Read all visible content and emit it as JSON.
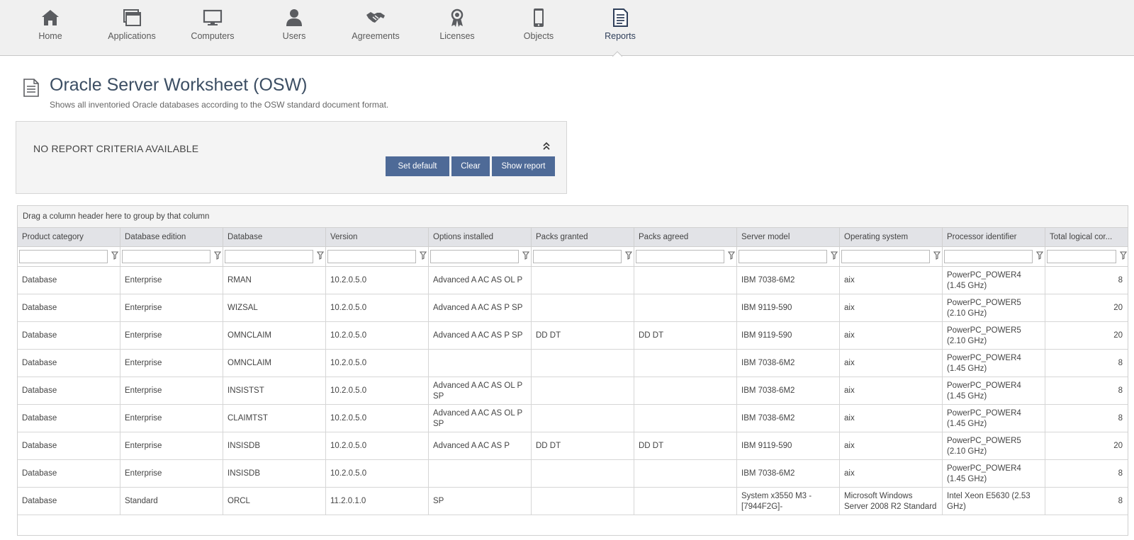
{
  "nav": {
    "items": [
      {
        "label": "Home",
        "icon": "home-icon"
      },
      {
        "label": "Applications",
        "icon": "applications-icon"
      },
      {
        "label": "Computers",
        "icon": "computer-icon"
      },
      {
        "label": "Users",
        "icon": "user-icon"
      },
      {
        "label": "Agreements",
        "icon": "handshake-icon"
      },
      {
        "label": "Licenses",
        "icon": "license-ribbon-icon"
      },
      {
        "label": "Objects",
        "icon": "mobile-device-icon"
      },
      {
        "label": "Reports",
        "icon": "report-document-icon"
      }
    ],
    "active": "Reports"
  },
  "header": {
    "title": "Oracle Server Worksheet (OSW)",
    "subtitle": "Shows all inventoried Oracle databases according to the OSW standard document format."
  },
  "criteria": {
    "text": "NO REPORT CRITERIA AVAILABLE",
    "buttons": {
      "set_default": "Set default",
      "clear": "Clear",
      "show_report": "Show report"
    }
  },
  "grid": {
    "group_hint": "Drag a column header here to group by that column",
    "columns": [
      "Product category",
      "Database edition",
      "Database",
      "Version",
      "Options installed",
      "Packs granted",
      "Packs agreed",
      "Server model",
      "Operating system",
      "Processor identifier",
      "Total logical cor..."
    ],
    "rows": [
      [
        "Database",
        "Enterprise",
        "RMAN",
        "10.2.0.5.0",
        "Advanced A AC AS OL P",
        "",
        "",
        "IBM 7038-6M2",
        "aix",
        "PowerPC_POWER4 (1.45 GHz)",
        "8"
      ],
      [
        "Database",
        "Enterprise",
        "WIZSAL",
        "10.2.0.5.0",
        "Advanced A AC AS P SP",
        "",
        "",
        "IBM 9119-590",
        "aix",
        "PowerPC_POWER5 (2.10 GHz)",
        "20"
      ],
      [
        "Database",
        "Enterprise",
        "OMNCLAIM",
        "10.2.0.5.0",
        "Advanced A AC AS P SP",
        "DD DT",
        "DD DT",
        "IBM 9119-590",
        "aix",
        "PowerPC_POWER5 (2.10 GHz)",
        "20"
      ],
      [
        "Database",
        "Enterprise",
        "OMNCLAIM",
        "10.2.0.5.0",
        "",
        "",
        "",
        "IBM 7038-6M2",
        "aix",
        "PowerPC_POWER4 (1.45 GHz)",
        "8"
      ],
      [
        "Database",
        "Enterprise",
        "INSISTST",
        "10.2.0.5.0",
        "Advanced A AC AS OL P SP",
        "",
        "",
        "IBM 7038-6M2",
        "aix",
        "PowerPC_POWER4 (1.45 GHz)",
        "8"
      ],
      [
        "Database",
        "Enterprise",
        "CLAIMTST",
        "10.2.0.5.0",
        "Advanced A AC AS OL P SP",
        "",
        "",
        "IBM 7038-6M2",
        "aix",
        "PowerPC_POWER4 (1.45 GHz)",
        "8"
      ],
      [
        "Database",
        "Enterprise",
        "INSISDB",
        "10.2.0.5.0",
        "Advanced A AC AS P",
        "DD DT",
        "DD DT",
        "IBM 9119-590",
        "aix",
        "PowerPC_POWER5 (2.10 GHz)",
        "20"
      ],
      [
        "Database",
        "Enterprise",
        "INSISDB",
        "10.2.0.5.0",
        "",
        "",
        "",
        "IBM 7038-6M2",
        "aix",
        "PowerPC_POWER4 (1.45 GHz)",
        "8"
      ],
      [
        "Database",
        "Standard",
        "ORCL",
        "11.2.0.1.0",
        "SP",
        "",
        "",
        "System x3550 M3 -[7944F2G]-",
        "Microsoft Windows Server 2008 R2 Standard",
        "Intel Xeon E5630 (2.53 GHz)",
        "8"
      ]
    ]
  }
}
